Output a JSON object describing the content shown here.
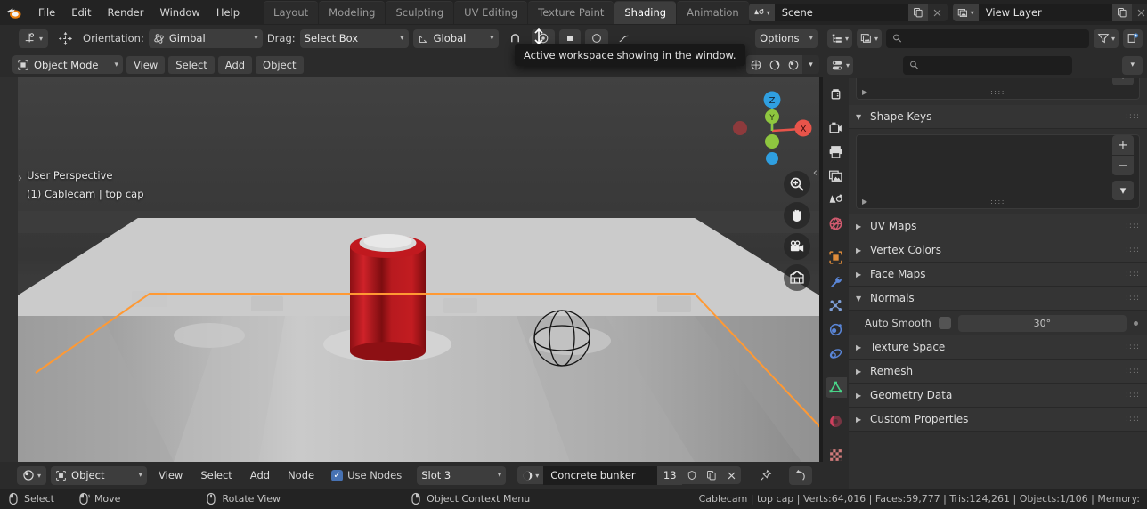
{
  "app": {
    "title": "Blender",
    "logo_icon": "blender-logo"
  },
  "topbar": {
    "menus": [
      "File",
      "Edit",
      "Render",
      "Window",
      "Help"
    ],
    "workspaces": [
      {
        "label": "Layout",
        "active": false
      },
      {
        "label": "Modeling",
        "active": false
      },
      {
        "label": "Sculpting",
        "active": false
      },
      {
        "label": "UV Editing",
        "active": false
      },
      {
        "label": "Texture Paint",
        "active": false
      },
      {
        "label": "Shading",
        "active": true
      },
      {
        "label": "Animation",
        "active": false
      }
    ],
    "scene": {
      "icon": "scene-icon",
      "name": "Scene",
      "new_icon": "duplicate-icon",
      "unlink_icon": "x-icon"
    },
    "view_layer": {
      "icon": "view-layer-icon",
      "name": "View Layer",
      "new_icon": "duplicate-icon",
      "unlink_icon": "x-icon"
    }
  },
  "tooltip": {
    "text": "Active workspace showing in the window."
  },
  "toolheader": {
    "editor_icon": "editor-type-icon",
    "transform_icon": "move-gizmo-icon",
    "orientation_label": "Orientation:",
    "orientation_value": "Gimbal",
    "drag_label": "Drag:",
    "drag_value": "Select Box",
    "snap_value": "Global",
    "options_label": "Options"
  },
  "viewheader": {
    "mode": "Object Mode",
    "mode_icon": "object-mode-icon",
    "menus": [
      "View",
      "Select",
      "Add",
      "Object"
    ],
    "shading_modes": [
      "wireframe",
      "solid",
      "material-preview",
      "rendered"
    ],
    "shading_active_index": 1
  },
  "viewport": {
    "perspective_label": "User Perspective",
    "object_label": "(1) Cablecam | top cap",
    "gizmo_axes": [
      "Z",
      "Y",
      "X"
    ],
    "nav_buttons": [
      "zoom-icon",
      "pan-hand-icon",
      "camera-view-icon",
      "toggle-ortho-icon"
    ],
    "colors": {
      "selection_outline": "#ff9933",
      "axis_x": "#e8544a",
      "axis_y": "#8ec63f",
      "axis_z": "#2f9fe0",
      "object_red": "#b3151a",
      "background": "#3b3b3b"
    }
  },
  "shaderheader": {
    "editor_icon": "shader-editor-icon",
    "shader_type": "Object",
    "shader_type_icon": "object-icon",
    "menus": [
      "View",
      "Select",
      "Add",
      "Node"
    ],
    "use_nodes_label": "Use Nodes",
    "use_nodes_checked": true,
    "slot": "Slot 3",
    "material_icon": "material-sphere-icon",
    "material_name": "Concrete bunker",
    "user_count": "13",
    "shield_icon": "fake-user-shield-icon",
    "copy_icon": "new-material-icon",
    "unlink_icon": "x-icon",
    "pin_icon": "pin-icon",
    "up_icon": "go-to-parent-icon"
  },
  "outliner_header": {
    "display_mode_icon": "outliner-display-icon",
    "filter_mode_icon": "view-layer-icon",
    "search_placeholder": "",
    "filter_icon": "filter-funnel-icon",
    "new_collection_icon": "new-collection-icon"
  },
  "properties_header": {
    "editor_icon": "properties-editor-icon",
    "search_placeholder": "",
    "options_caret": "chevron-down-icon"
  },
  "properties_tabs": [
    {
      "name": "tool",
      "icon": "tool-icon",
      "color": "#d7d7d7",
      "active": false
    },
    {
      "name": "render",
      "icon": "render-camera-icon",
      "color": "#d7d7d7",
      "active": false
    },
    {
      "name": "output",
      "icon": "output-printer-icon",
      "color": "#d7d7d7",
      "active": false
    },
    {
      "name": "view-layer",
      "icon": "view-layer-images-icon",
      "color": "#d7d7d7",
      "active": false
    },
    {
      "name": "scene",
      "icon": "scene-cone-icon",
      "color": "#d7d7d7",
      "active": false
    },
    {
      "name": "world",
      "icon": "world-globe-icon",
      "color": "#d05a6e",
      "active": false
    },
    {
      "name": "object",
      "icon": "object-square-icon",
      "color": "#e08c3a",
      "active": false
    },
    {
      "name": "modifiers",
      "icon": "wrench-icon",
      "color": "#5a86d8",
      "active": false
    },
    {
      "name": "particles",
      "icon": "particles-icon",
      "color": "#7f9fd6",
      "active": false
    },
    {
      "name": "physics",
      "icon": "physics-orbit-icon",
      "color": "#5a86d8",
      "active": false
    },
    {
      "name": "constraints",
      "icon": "constraints-icon",
      "color": "#5a86d8",
      "active": false
    },
    {
      "name": "object-data",
      "icon": "mesh-data-triangle-icon",
      "color": "#49d488",
      "active": true
    },
    {
      "name": "material",
      "icon": "material-ball-icon",
      "color": "#d0405e",
      "active": false
    },
    {
      "name": "texture",
      "icon": "texture-checker-icon",
      "color": "#d07b7b",
      "active": false
    }
  ],
  "properties_panels": [
    {
      "label": "Shape Keys",
      "expanded": true,
      "has_list": true
    },
    {
      "label": "UV Maps",
      "expanded": false,
      "has_list": false
    },
    {
      "label": "Vertex Colors",
      "expanded": false,
      "has_list": false
    },
    {
      "label": "Face Maps",
      "expanded": false,
      "has_list": false
    },
    {
      "label": "Normals",
      "expanded": true,
      "has_list": false
    },
    {
      "label": "Texture Space",
      "expanded": false,
      "has_list": false
    },
    {
      "label": "Remesh",
      "expanded": false,
      "has_list": false
    },
    {
      "label": "Geometry Data",
      "expanded": false,
      "has_list": false
    },
    {
      "label": "Custom Properties",
      "expanded": false,
      "has_list": false
    }
  ],
  "normals_panel": {
    "auto_smooth_label": "Auto Smooth",
    "auto_smooth_checked": false,
    "angle_value": "30°"
  },
  "statusbar": {
    "hints": [
      {
        "icon": "mouse-left-icon",
        "label": "Select"
      },
      {
        "icon": "mouse-move-icon",
        "label": "Move"
      },
      {
        "icon": "mouse-middle-icon",
        "label": "Rotate View"
      },
      {
        "icon": "mouse-right-icon",
        "label": "Object Context Menu"
      }
    ],
    "stats": "Cablecam | top cap | Verts:64,016 | Faces:59,777 | Tris:124,261 | Objects:1/106 | Memory:"
  }
}
